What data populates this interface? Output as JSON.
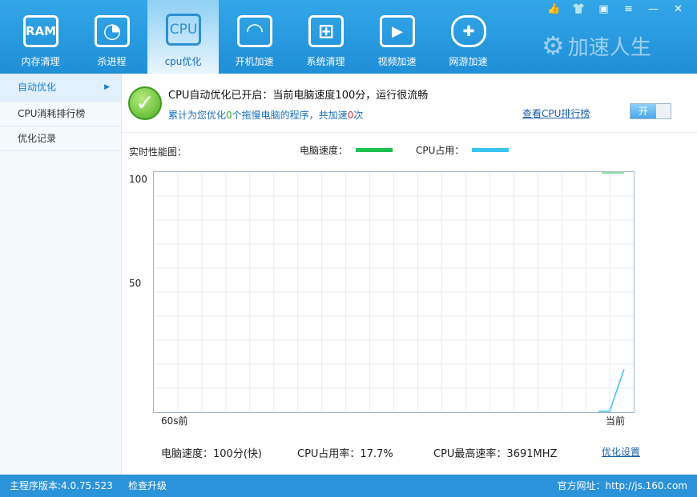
{
  "nav": [
    {
      "label": "内存清理",
      "icon": "ram-icon",
      "glyph": "RAM"
    },
    {
      "label": "杀进程",
      "icon": "pie-icon",
      "glyph": "◔"
    },
    {
      "label": "cpu优化",
      "icon": "cpu-icon",
      "glyph": "CPU",
      "active": true
    },
    {
      "label": "开机加速",
      "icon": "speedometer-icon",
      "glyph": "◠"
    },
    {
      "label": "系统清理",
      "icon": "windows-icon",
      "glyph": "⊞"
    },
    {
      "label": "视频加速",
      "icon": "play-icon",
      "glyph": "▶"
    },
    {
      "label": "网游加速",
      "icon": "gamepad-icon",
      "glyph": "✚"
    }
  ],
  "brand": "加速人生",
  "sidebar": {
    "items": [
      {
        "label": "自动优化"
      },
      {
        "label": "CPU消耗排行榜"
      },
      {
        "label": "优化记录"
      }
    ]
  },
  "status": {
    "title": "CPU自动优化已开启：当前电脑速度100分，运行很流畅",
    "sub_prefix": "累计为您优化",
    "sub_count": "0",
    "sub_mid": "个拖慢电脑的程序，共加速",
    "sub_times": "0",
    "sub_suffix": "次",
    "rank_link": "查看CPU排行榜",
    "toggle_label": "开"
  },
  "chart_data": {
    "type": "line",
    "title": "实时性能图：",
    "xlabel": "",
    "ylabel": "",
    "x_ticks": [
      "60s前",
      "当前"
    ],
    "y_ticks": [
      "100",
      "50"
    ],
    "ylim": [
      0,
      100
    ],
    "grid": true,
    "series": [
      {
        "name": "电脑速度：",
        "color": "#1fbf4f",
        "values": [
          100
        ]
      },
      {
        "name": "CPU占用：",
        "color": "#39c3f0",
        "values": [
          0,
          17.7
        ]
      }
    ]
  },
  "stats": {
    "speed": "电脑速度：100分(快)",
    "cpu_usage": "CPU占用率：17.7%",
    "cpu_max": "CPU最高速率：3691MHZ",
    "settings_link": "优化设置"
  },
  "statusbar": {
    "version": "主程序版本:4.0.75.523",
    "update": "检查升级",
    "site": "官方网址：http://js.160.com"
  }
}
